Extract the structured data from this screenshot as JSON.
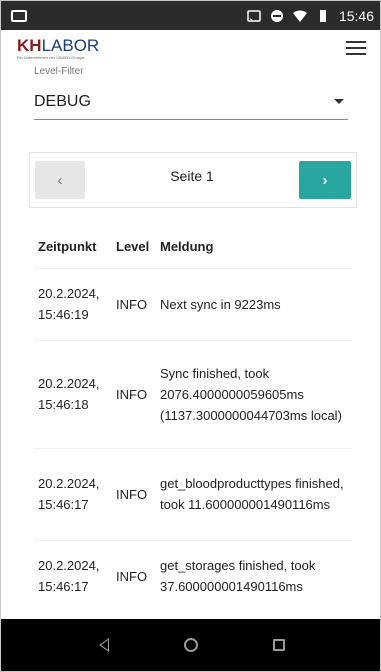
{
  "statusbar": {
    "time": "15:46"
  },
  "appbar": {
    "logo_kh": "KH",
    "logo_labor": "LABOR",
    "logo_sub": "Ein Unternehmen der VAMED Gruppe"
  },
  "filter": {
    "label": "Level-Filter",
    "value": "DEBUG"
  },
  "pager": {
    "prev_label": "‹",
    "page_label": "Seite 1",
    "next_label": "›"
  },
  "table": {
    "headers": [
      "Zeitpunkt",
      "Level",
      "Meldung"
    ],
    "rows": [
      {
        "time": "20.2.2024, 15:46:19",
        "level": "INFO",
        "message": "Next sync in 9223ms"
      },
      {
        "time": "20.2.2024, 15:46:18",
        "level": "INFO",
        "message": "Sync finished, took 2076.4000000059605ms (1137.3000000044703ms local)"
      },
      {
        "time": "20.2.2024, 15:46:17",
        "level": "INFO",
        "message": "get_bloodproducttypes finished, took 11.600000001490116ms"
      },
      {
        "time": "20.2.2024, 15:46:17",
        "level": "INFO",
        "message": "get_storages finished, took 37.600000001490116ms"
      }
    ]
  }
}
